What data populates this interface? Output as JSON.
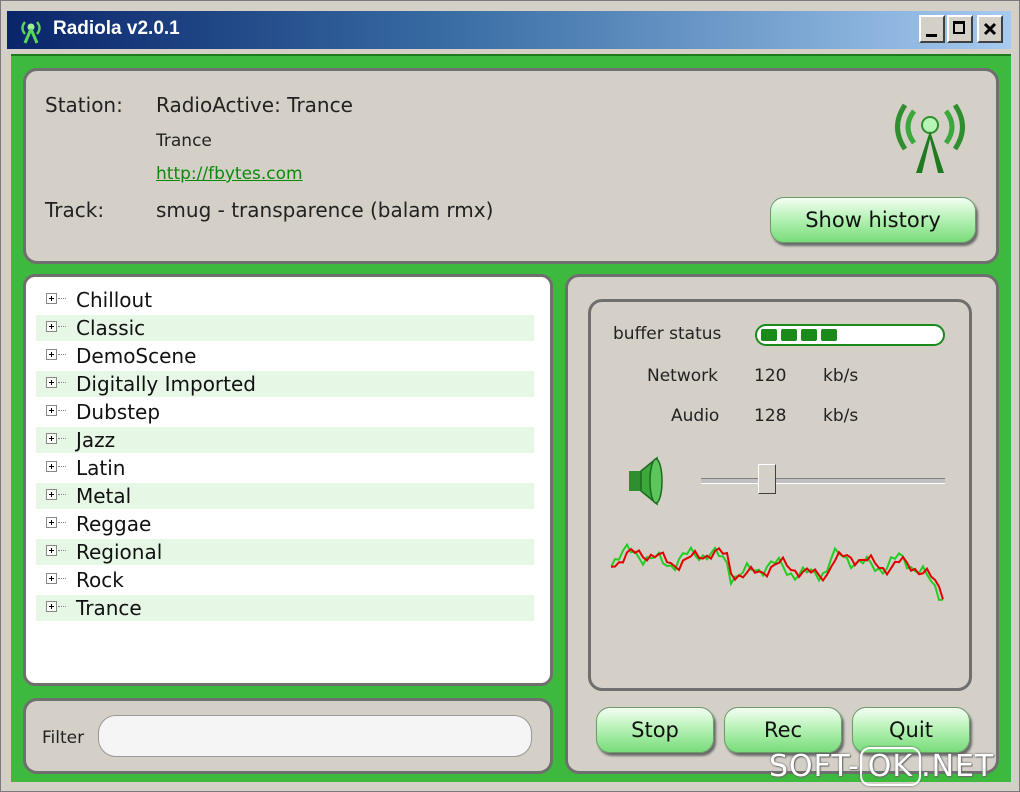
{
  "window": {
    "title": "Radiola v2.0.1"
  },
  "station": {
    "label": "Station:",
    "name": "RadioActive: Trance",
    "genre": "Trance",
    "url": "http://fbytes.com",
    "track_label": "Track:",
    "track": "smug -  transparence (balam rmx)",
    "history_button": "Show history"
  },
  "genres": [
    "Chillout",
    "Classic",
    "DemoScene",
    "Digitally Imported",
    "Dubstep",
    "Jazz",
    "Latin",
    "Metal",
    "Reggae",
    "Regional",
    "Rock",
    "Trance"
  ],
  "filter": {
    "label": "Filter",
    "value": ""
  },
  "stats": {
    "buffer_label": "buffer status",
    "buffer_level": 0.45,
    "network_label": "Network",
    "network_value": "120",
    "network_unit": "kb/s",
    "audio_label": "Audio",
    "audio_value": "128",
    "audio_unit": "kb/s",
    "volume": 0.25
  },
  "controls": {
    "stop": "Stop",
    "rec": "Rec",
    "quit": "Quit"
  },
  "colors": {
    "accent": "#3db93d",
    "wave_left": "#e00000",
    "wave_right": "#22cc22"
  },
  "watermark": {
    "left": "SOFT-",
    "mid": "OK",
    "right": ".NET"
  }
}
